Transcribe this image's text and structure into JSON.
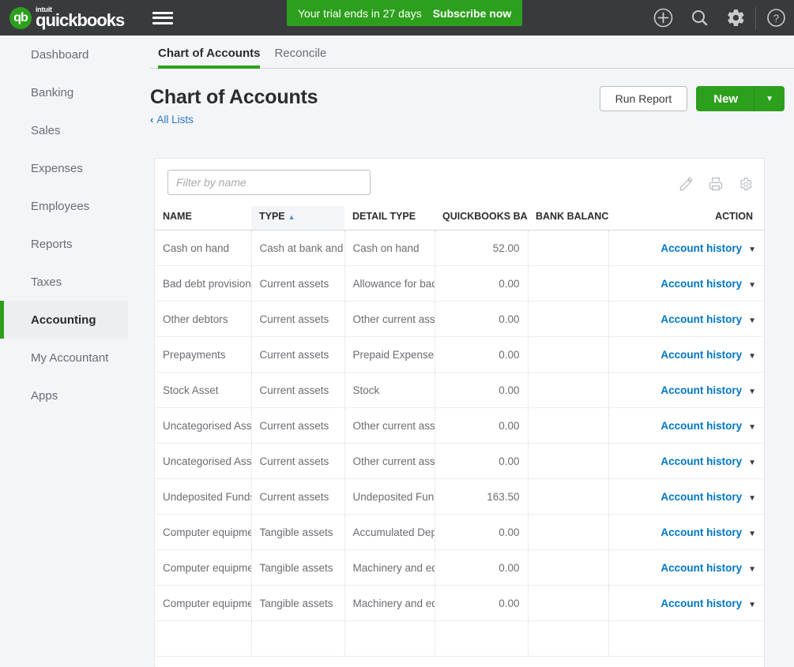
{
  "topbar": {
    "brand_intuit": "intuit",
    "brand_name": "quickbooks",
    "logo_initials": "qb",
    "trial_text": "Your trial ends in 27 days",
    "subscribe_label": "Subscribe now",
    "icons": [
      "add-icon",
      "search-icon",
      "gear-icon",
      "help-icon"
    ],
    "brand_green": "#2ca01c",
    "bar_color": "#393a3d"
  },
  "sidebar": {
    "items": [
      {
        "label": "Dashboard",
        "active": false
      },
      {
        "label": "Banking",
        "active": false
      },
      {
        "label": "Sales",
        "active": false
      },
      {
        "label": "Expenses",
        "active": false
      },
      {
        "label": "Employees",
        "active": false
      },
      {
        "label": "Reports",
        "active": false
      },
      {
        "label": "Taxes",
        "active": false
      },
      {
        "label": "Accounting",
        "active": true
      },
      {
        "label": "My Accountant",
        "active": false
      },
      {
        "label": "Apps",
        "active": false
      }
    ]
  },
  "tabs": [
    {
      "label": "Chart of Accounts",
      "active": true
    },
    {
      "label": "Reconcile",
      "active": false
    }
  ],
  "page": {
    "title": "Chart of Accounts",
    "breadcrumb": "All Lists",
    "run_report_label": "Run Report",
    "new_label": "New"
  },
  "toolbar": {
    "filter_placeholder": "Filter by name",
    "filter_value": "",
    "icons": [
      "pencil-icon",
      "printer-icon",
      "gear-icon"
    ]
  },
  "table": {
    "columns": [
      {
        "key": "name",
        "label": "NAME",
        "sorted": false
      },
      {
        "key": "type",
        "label": "TYPE",
        "sorted": true,
        "sort_dir": "asc"
      },
      {
        "key": "detail_type",
        "label": "DETAIL TYPE",
        "sorted": false
      },
      {
        "key": "quickbooks_balance",
        "label": "QUICKBOOKS BALANCE",
        "sorted": false
      },
      {
        "key": "bank_balance",
        "label": "BANK BALANCE",
        "sorted": false
      },
      {
        "key": "action",
        "label": "ACTION",
        "sorted": false
      }
    ],
    "action_label": "Account history",
    "rows": [
      {
        "name": "Cash on hand",
        "type": "Cash at bank and in hand",
        "detail_type": "Cash on hand",
        "quickbooks_balance": "52.00",
        "bank_balance": ""
      },
      {
        "name": "Bad debt provision",
        "type": "Current assets",
        "detail_type": "Allowance for bad debts",
        "quickbooks_balance": "0.00",
        "bank_balance": ""
      },
      {
        "name": "Other debtors",
        "type": "Current assets",
        "detail_type": "Other current assets",
        "quickbooks_balance": "0.00",
        "bank_balance": ""
      },
      {
        "name": "Prepayments",
        "type": "Current assets",
        "detail_type": "Prepaid Expenses",
        "quickbooks_balance": "0.00",
        "bank_balance": ""
      },
      {
        "name": "Stock Asset",
        "type": "Current assets",
        "detail_type": "Stock",
        "quickbooks_balance": "0.00",
        "bank_balance": ""
      },
      {
        "name": "Uncategorised Asset",
        "type": "Current assets",
        "detail_type": "Other current assets",
        "quickbooks_balance": "0.00",
        "bank_balance": ""
      },
      {
        "name": "Uncategorised Asset",
        "type": "Current assets",
        "detail_type": "Other current assets",
        "quickbooks_balance": "0.00",
        "bank_balance": ""
      },
      {
        "name": "Undeposited Funds",
        "type": "Current assets",
        "detail_type": "Undeposited Funds",
        "quickbooks_balance": "163.50",
        "bank_balance": ""
      },
      {
        "name": "Computer equipment",
        "type": "Tangible assets",
        "detail_type": "Accumulated Depreciation",
        "quickbooks_balance": "0.00",
        "bank_balance": ""
      },
      {
        "name": "Computer equipment",
        "type": "Tangible assets",
        "detail_type": "Machinery and equipment",
        "quickbooks_balance": "0.00",
        "bank_balance": ""
      },
      {
        "name": "Computer equipment",
        "type": "Tangible assets",
        "detail_type": "Machinery and equipment",
        "quickbooks_balance": "0.00",
        "bank_balance": ""
      },
      {
        "name": "",
        "type": "",
        "detail_type": "",
        "quickbooks_balance": "",
        "bank_balance": ""
      }
    ]
  }
}
